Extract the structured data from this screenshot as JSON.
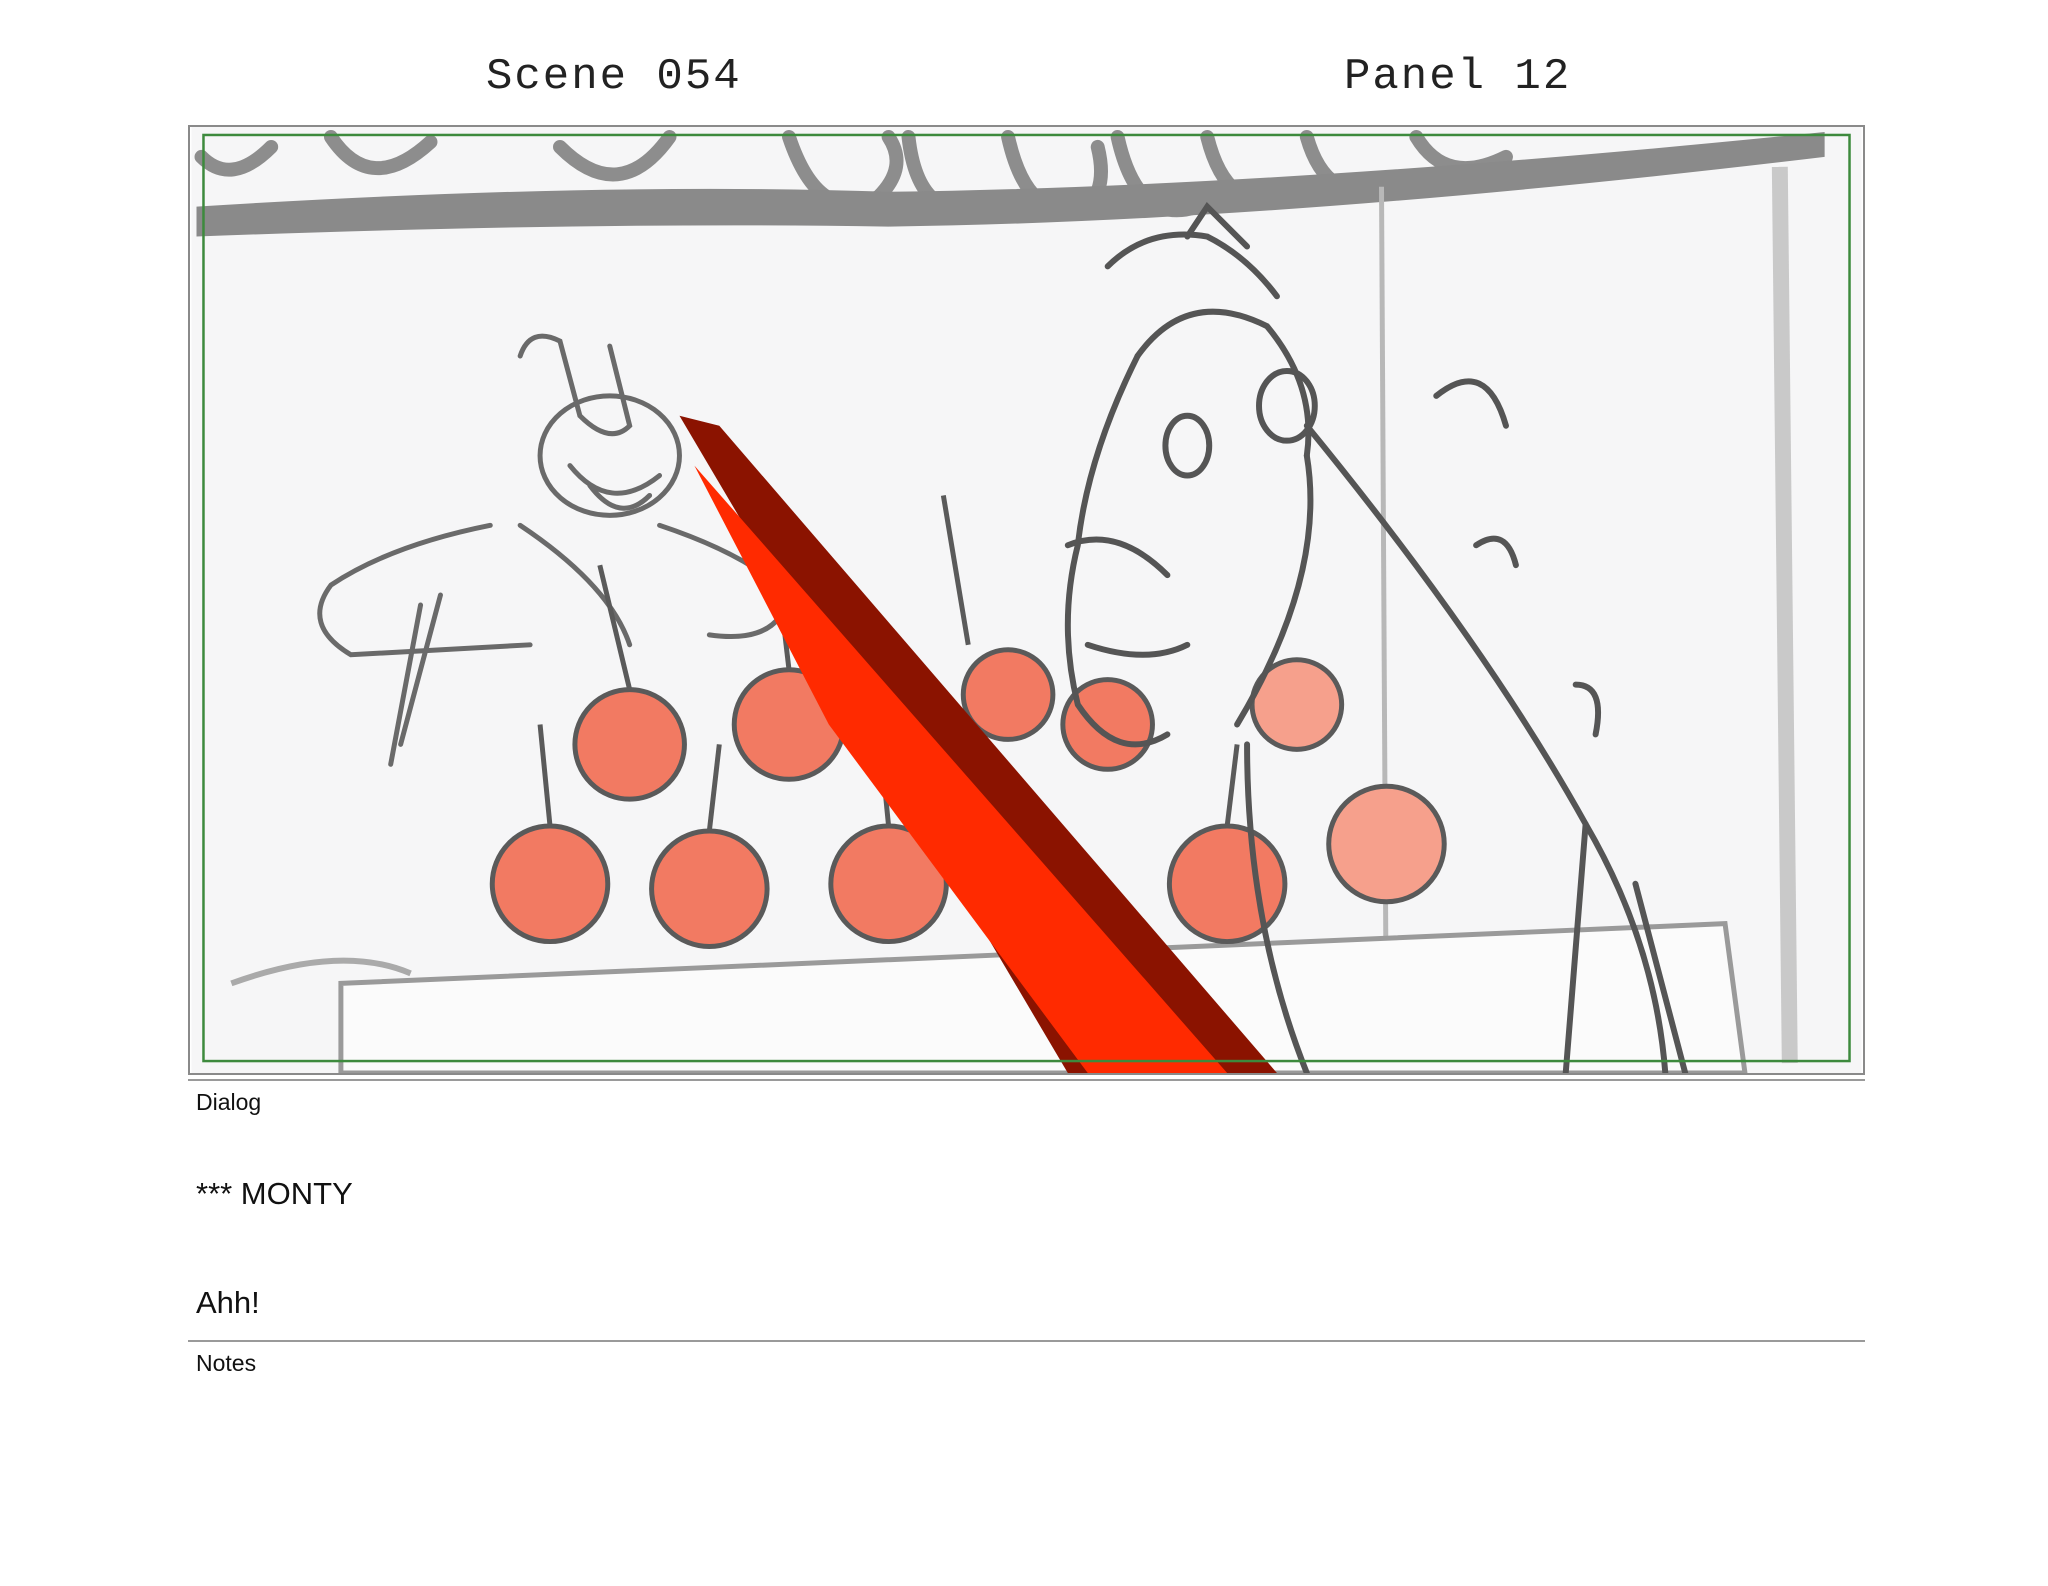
{
  "header": {
    "scene": "Scene 054",
    "panel": "Panel 12"
  },
  "panel_image": {
    "alt": "Storyboard sketch: a shopkeeper behind a stall of candy apples and a horse leaning in, with a red arrow pointing across the frame",
    "colors": {
      "sketch_line": "#5e5e5e",
      "apple": "#f4735a",
      "arrow_light": "#ff2a00",
      "arrow_dark": "#8b1300",
      "safe_frame": "#3d8a3d"
    }
  },
  "dialog": {
    "label": "Dialog",
    "speaker": "*** MONTY",
    "line": "Ahh!"
  },
  "notes": {
    "label": "Notes",
    "text": ""
  }
}
